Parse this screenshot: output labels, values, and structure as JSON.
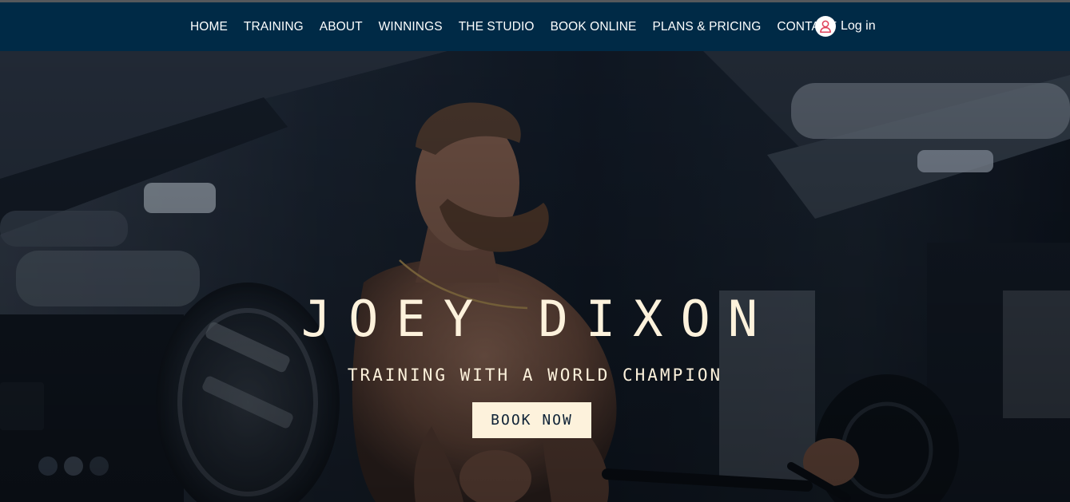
{
  "nav": {
    "items": [
      {
        "label": "HOME"
      },
      {
        "label": "TRAINING"
      },
      {
        "label": "ABOUT"
      },
      {
        "label": "WINNINGS"
      },
      {
        "label": "THE STUDIO"
      },
      {
        "label": "BOOK ONLINE"
      },
      {
        "label": "PLANS & PRICING"
      },
      {
        "label": "CONTACT"
      }
    ],
    "login_label": "Log in",
    "login_icon": "user-icon"
  },
  "hero": {
    "title": "JOEY DIXON",
    "subtitle": "TRAINING WITH A WORLD CHAMPION",
    "cta_label": "BOOK NOW",
    "background": "gym-athlete-photo"
  },
  "colors": {
    "nav_bg": "#002a46",
    "accent_cream": "#fdf2dc",
    "login_icon": "#e0415a"
  }
}
